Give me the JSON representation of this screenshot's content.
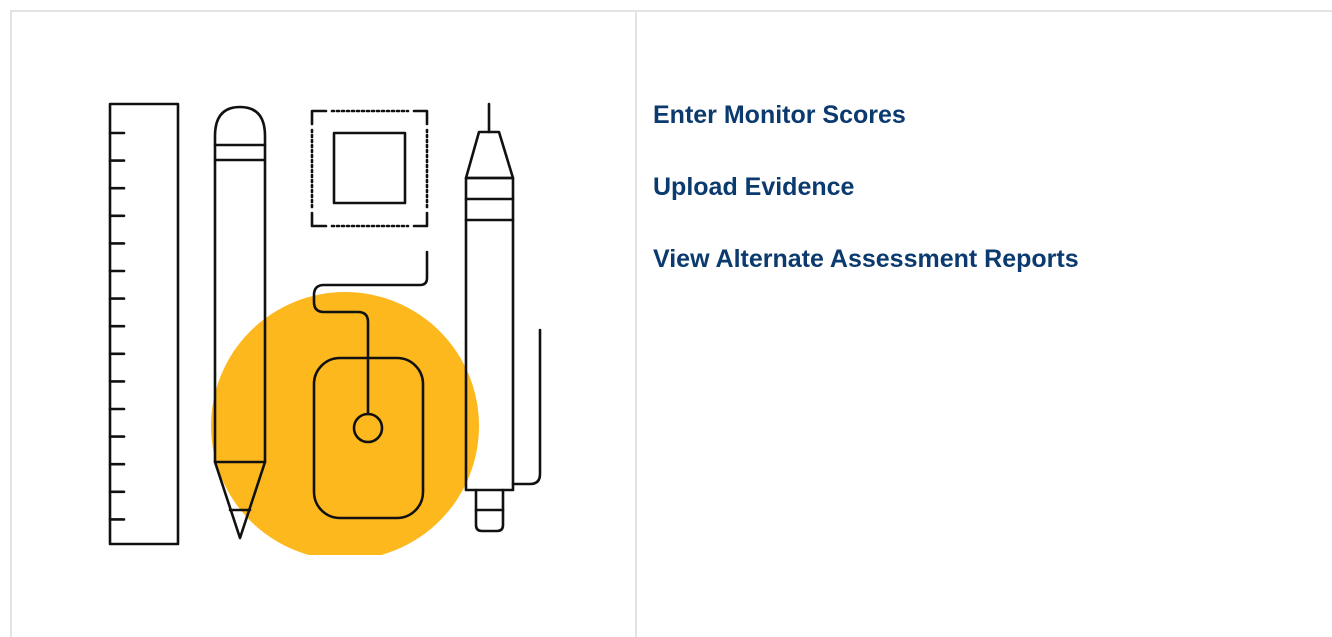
{
  "illustration": {
    "icon": "tools-illustration-icon",
    "accent_color": "#fdb81e",
    "stroke_color": "#111111"
  },
  "links": [
    {
      "label": "Enter Monitor Scores"
    },
    {
      "label": "Upload Evidence"
    },
    {
      "label": "View Alternate Assessment Reports"
    }
  ],
  "colors": {
    "link": "#0b3a6e",
    "divider": "#e3e3e3"
  }
}
